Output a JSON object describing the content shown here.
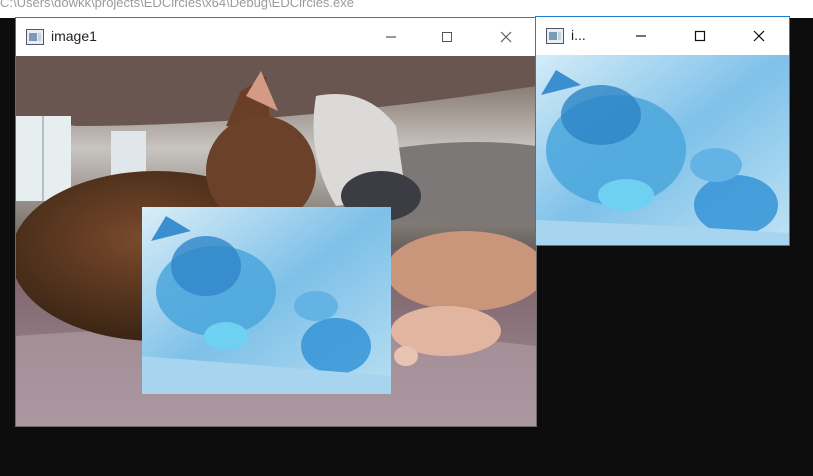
{
  "console": {
    "title": "C:\\Users\\dowkk\\projects\\EDCircles\\x64\\Debug\\EDCircles.exe"
  },
  "main_window": {
    "title": "image1",
    "icon": "window-app-icon",
    "controls": [
      "minimize-icon",
      "maximize-icon",
      "close-icon"
    ]
  },
  "small_window": {
    "title": "i...",
    "icon": "window-app-icon",
    "controls": [
      "minimize-icon",
      "maximize-icon",
      "close-icon"
    ]
  },
  "colors": {
    "desktop": "#0c0c0c",
    "small_window_border": "#1f7fd1",
    "inverted_tint": "#4aa6dc"
  }
}
